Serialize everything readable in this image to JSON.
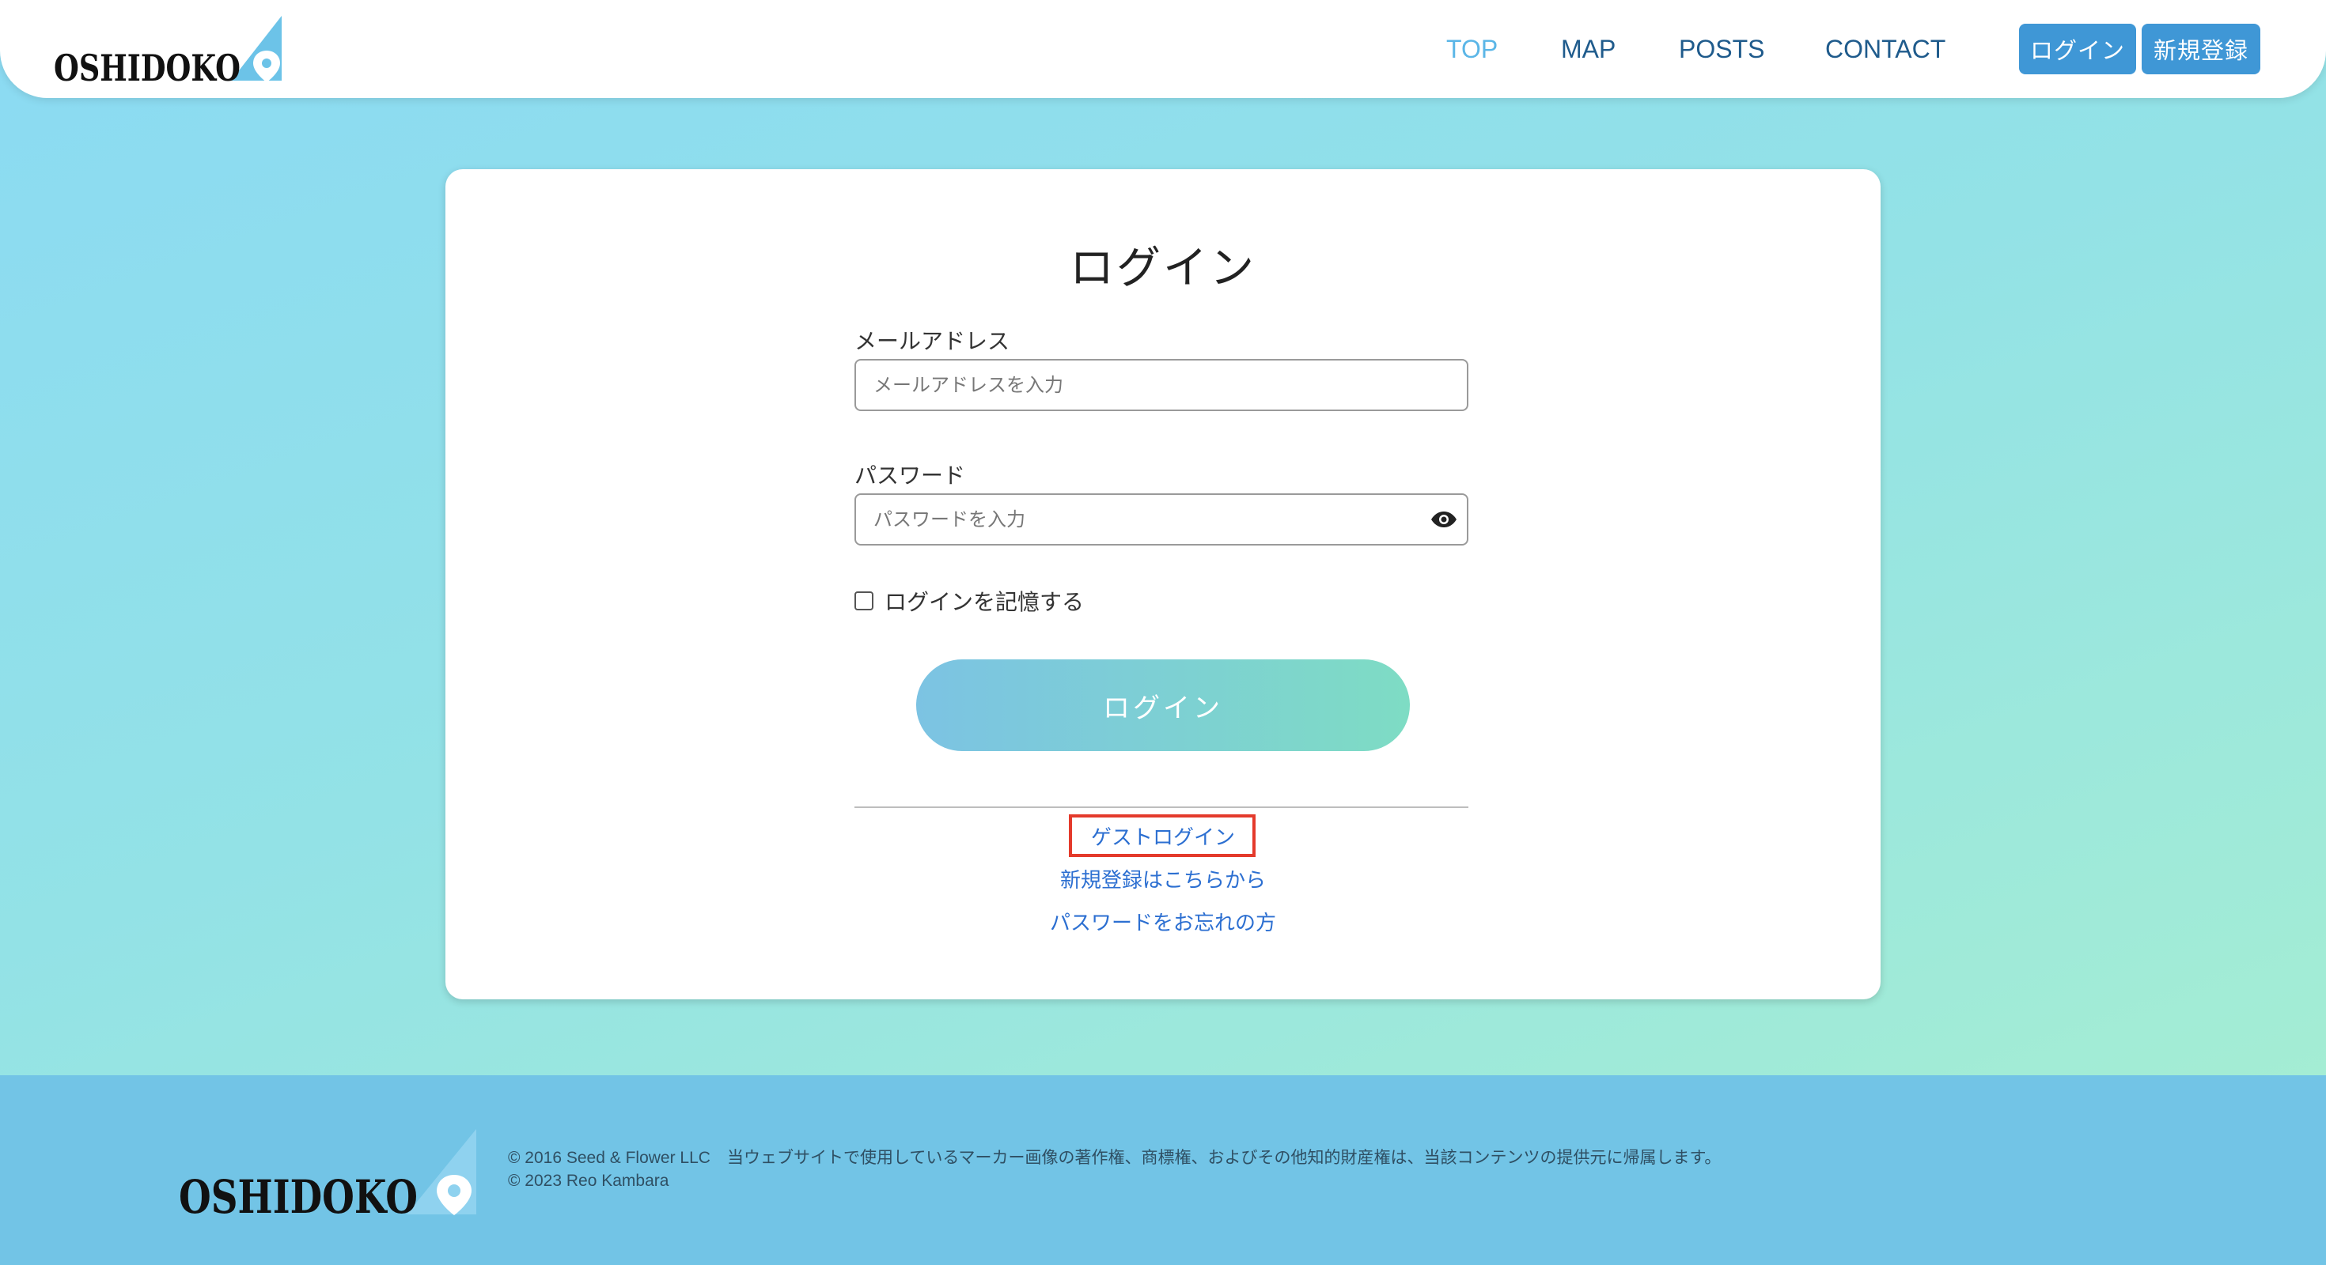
{
  "header": {
    "logo_text": "OSHIDOKO",
    "nav": [
      "TOP",
      "MAP",
      "POSTS",
      "CONTACT"
    ],
    "active_nav": "TOP",
    "login_button": "ログイン",
    "signup_button": "新規登録"
  },
  "form": {
    "title": "ログイン",
    "email_label": "メールアドレス",
    "email_placeholder": "メールアドレスを入力",
    "email_value": "",
    "password_label": "パスワード",
    "password_placeholder": "パスワードを入力",
    "password_value": "",
    "remember_label": "ログインを記憶する",
    "remember_checked": false,
    "submit_label": "ログイン",
    "links": {
      "guest": "ゲストログイン",
      "signup": "新規登録はこちらから",
      "forgot": "パスワードをお忘れの方"
    }
  },
  "footer": {
    "logo_text": "OSHIDOKO",
    "line1": "© 2016 Seed & Flower LLC　当ウェブサイトで使用しているマーカー画像の著作権、商標権、およびその他知的財産権は、当該コンテンツの提供元に帰属します。",
    "line2": "© 2023 Reo Kambara"
  },
  "colors": {
    "header_button": "#3f97d6",
    "nav_text": "#1f5b8c",
    "nav_active": "#5bb6e7",
    "link": "#2c6fd1",
    "highlight_box": "#e43a2b",
    "footer_bg": "#72c4e6"
  },
  "icons": {
    "password_toggle": "eye-icon",
    "logo_pin": "map-pin-icon"
  }
}
